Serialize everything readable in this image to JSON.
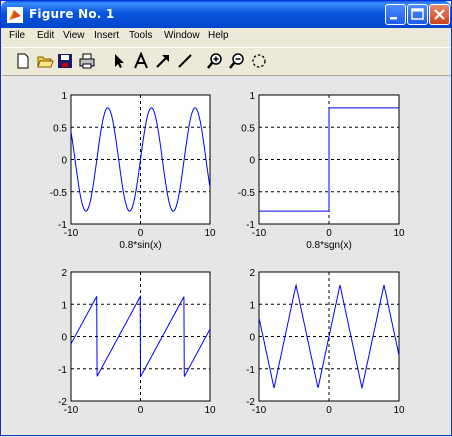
{
  "window": {
    "title": "Figure No. 1",
    "controls": {
      "minimize": "minimize",
      "maximize": "maximize",
      "close": "close"
    }
  },
  "menu": [
    "File",
    "Edit",
    "View",
    "Insert",
    "Tools",
    "Window",
    "Help"
  ],
  "toolbar": [
    "new-figure-icon",
    "open-icon",
    "save-icon",
    "print-icon",
    "arrow-icon",
    "text-icon",
    "arrow-line-icon",
    "line-icon",
    "zoom-in-icon",
    "zoom-out-icon",
    "rotate-icon"
  ],
  "chart_data": [
    {
      "type": "line",
      "title": "",
      "xlabel": "0.8*sin(x)",
      "ylabel": "",
      "xlim": [
        -10,
        10
      ],
      "ylim": [
        -1,
        1
      ],
      "xticks": [
        "-10",
        "0",
        "10"
      ],
      "yticks": [
        "1",
        "0.5",
        "0",
        "-0.5",
        "-1"
      ],
      "series": [
        {
          "func": "0.8*sin(x)",
          "x_range": [
            -10,
            10
          ]
        }
      ]
    },
    {
      "type": "line",
      "title": "",
      "xlabel": "0.8*sgn(x)",
      "ylabel": "",
      "xlim": [
        -10,
        10
      ],
      "ylim": [
        -1,
        1
      ],
      "xticks": [
        "-10",
        "0",
        "10"
      ],
      "yticks": [
        "1",
        "0.5",
        "0",
        "-0.5",
        "-1"
      ],
      "series": [
        {
          "x": [
            -10,
            0,
            0,
            10
          ],
          "y": [
            -0.8,
            -0.8,
            0.8,
            0.8
          ]
        }
      ]
    },
    {
      "type": "line",
      "title": "",
      "xlabel": "",
      "ylabel": "",
      "xlim": [
        -10,
        10
      ],
      "ylim": [
        -2,
        2
      ],
      "xticks": [
        "-10",
        "0",
        "10"
      ],
      "yticks": [
        "2",
        "1",
        "0",
        "-1",
        "-2"
      ],
      "series": [
        {
          "func": "sawtooth(x)",
          "x_range": [
            -10,
            10
          ]
        }
      ]
    },
    {
      "type": "line",
      "title": "",
      "xlabel": "",
      "ylabel": "",
      "xlim": [
        -10,
        10
      ],
      "ylim": [
        -2,
        2
      ],
      "xticks": [
        "-10",
        "0",
        "10"
      ],
      "yticks": [
        "2",
        "1",
        "0",
        "-1",
        "-2"
      ],
      "series": [
        {
          "func": "triangle(x)",
          "x_range": [
            -10,
            10
          ]
        }
      ]
    }
  ]
}
